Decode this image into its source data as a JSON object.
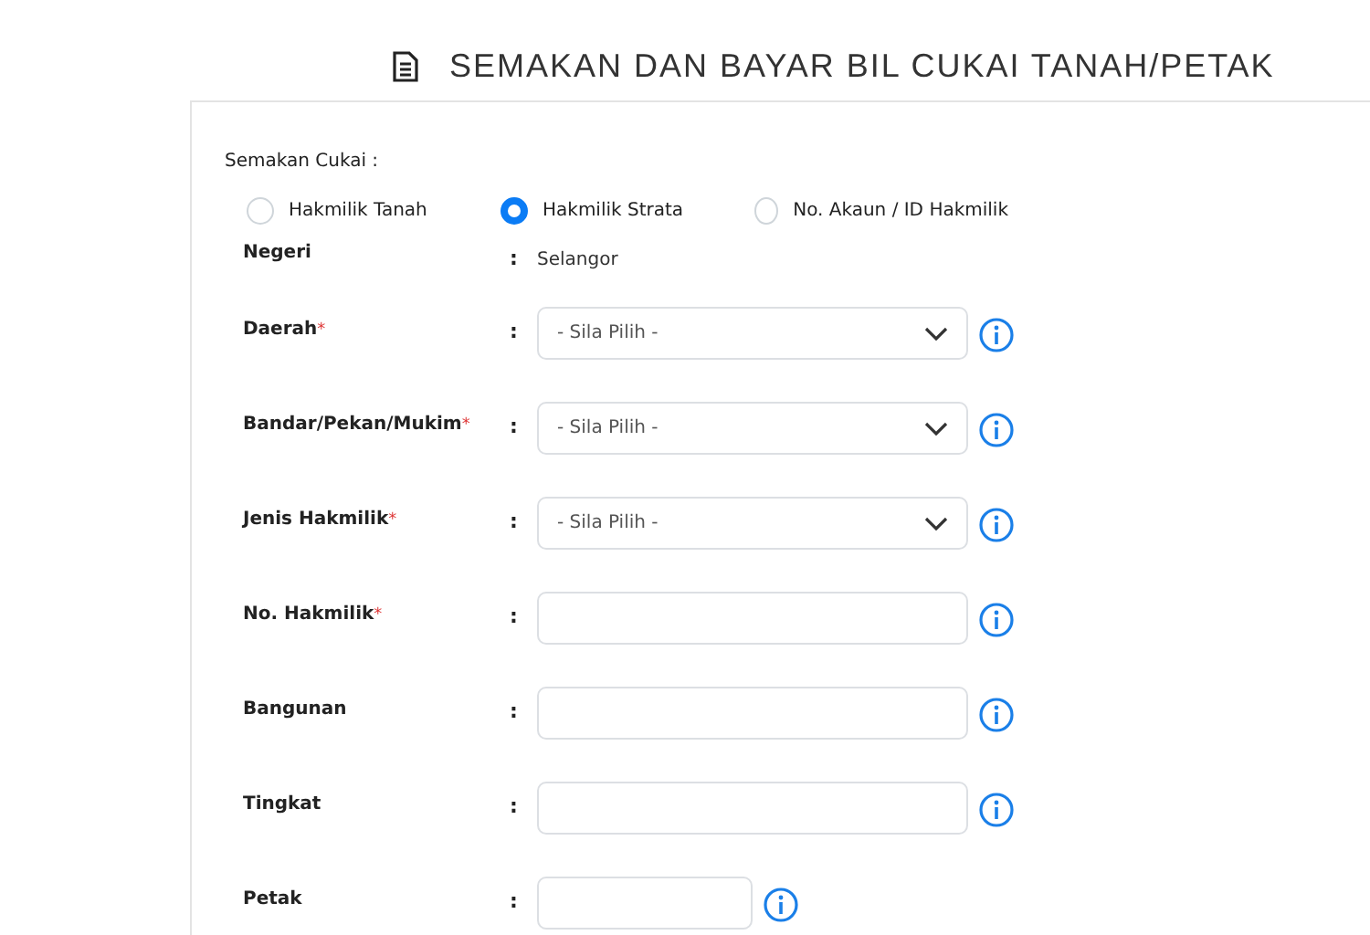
{
  "title": "SEMAKAN DAN BAYAR BIL CUKAI TANAH/PETAK",
  "check_label": "Semakan Cukai :",
  "options": [
    {
      "label": "Hakmilik Tanah",
      "selected": false
    },
    {
      "label": "Hakmilik Strata",
      "selected": true
    },
    {
      "label": "No. Akaun / ID Hakmilik",
      "selected": false
    }
  ],
  "fields": [
    {
      "kind": "text",
      "label": "Negeri",
      "required": false,
      "value": "Selangor"
    },
    {
      "kind": "select",
      "label": "Daerah",
      "required": true,
      "placeholder": "- Sila Pilih -"
    },
    {
      "kind": "select",
      "label": "Bandar/Pekan/Mukim",
      "required": true,
      "placeholder": "- Sila Pilih -"
    },
    {
      "kind": "select",
      "label": "Jenis Hakmilik",
      "required": true,
      "placeholder": "- Sila Pilih -"
    },
    {
      "kind": "input",
      "label": "No. Hakmilik",
      "required": true
    },
    {
      "kind": "input",
      "label": "Bangunan",
      "required": false
    },
    {
      "kind": "input",
      "label": "Tingkat",
      "required": false
    },
    {
      "kind": "short-input",
      "label": "Petak",
      "required": false
    }
  ],
  "separator": ":",
  "required_mark": "*"
}
